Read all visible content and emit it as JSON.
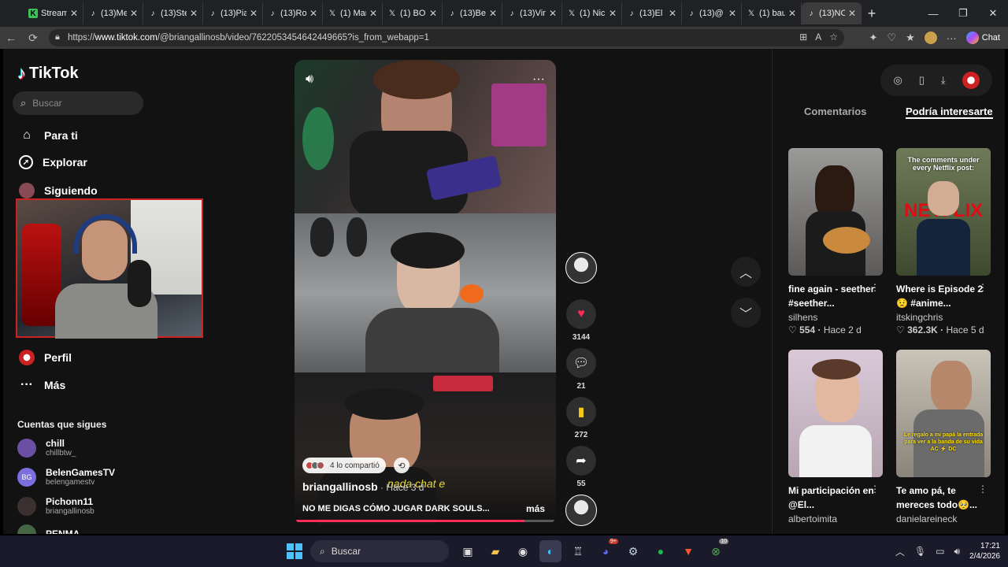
{
  "browser": {
    "tabs": [
      {
        "title": "Stream",
        "icon": "kick-icon"
      },
      {
        "title": "(13)Me",
        "icon": "tiktok-icon"
      },
      {
        "title": "(13)Ste",
        "icon": "tiktok-icon"
      },
      {
        "title": "(13)Pia",
        "icon": "tiktok-icon"
      },
      {
        "title": "(13)Ro",
        "icon": "tiktok-icon"
      },
      {
        "title": "(1) Mar",
        "icon": "x-icon"
      },
      {
        "title": "(1) BO",
        "icon": "x-icon"
      },
      {
        "title": "(13)Be",
        "icon": "tiktok-icon"
      },
      {
        "title": "(13)Vin",
        "icon": "tiktok-icon"
      },
      {
        "title": "(1) Nic",
        "icon": "x-icon"
      },
      {
        "title": "(13)El",
        "icon": "tiktok-icon"
      },
      {
        "title": "(13)@",
        "icon": "tiktok-icon"
      },
      {
        "title": "(1) bau",
        "icon": "x-icon"
      },
      {
        "title": "(13)NO",
        "icon": "tiktok-icon"
      }
    ],
    "url_prefix": "https://",
    "url_host": "www.tiktok.com",
    "url_path": "/@briangallinosb/video/7622053454642449665?is_from_webapp=1",
    "chat_label": "Chat"
  },
  "sidebar": {
    "logo": "TikTok",
    "search_placeholder": "Buscar",
    "items": [
      {
        "label": "Para ti",
        "icon": "home-icon"
      },
      {
        "label": "Explorar",
        "icon": "compass-icon"
      },
      {
        "label": "Siguiendo",
        "icon": "following-icon"
      },
      {
        "label": "Perfil",
        "icon": "profile-icon"
      },
      {
        "label": "Más",
        "icon": "more-icon"
      }
    ],
    "following_header": "Cuentas que sigues",
    "accounts": [
      {
        "name": "chill",
        "handle": "chillbtw_",
        "initials": "",
        "color": "#6a4fa3"
      },
      {
        "name": "BelenGamesTV",
        "handle": "belengamestv",
        "initials": "BG",
        "color": "#7b6fe0"
      },
      {
        "name": "Pichonn11",
        "handle": "briangallinosb",
        "initials": "",
        "color": "#3a3030"
      },
      {
        "name": "PENMA",
        "handle": "",
        "initials": "",
        "color": "#446644"
      }
    ]
  },
  "video": {
    "shared_text": "4 lo compartió",
    "author": "briangallinosb",
    "time_ago": " · Hace 3 d",
    "subtitle": "nada chat e",
    "caption": "NO ME DIGAS CÓMO JUGAR DARK SOULS...",
    "more_label": "más",
    "progress": 0.88
  },
  "actions": {
    "likes": "3144",
    "comments": "21",
    "saves": "272",
    "shares": "55"
  },
  "right_panel": {
    "tab_comments": "Comentarios",
    "tab_suggested": "Podría interesarte",
    "cards": [
      {
        "title": "fine again - seether #seether...",
        "user": "silhens",
        "likes": "554",
        "age": "Hace 2 d",
        "thumb_text": "",
        "thumb_overlay": ""
      },
      {
        "title": "Where is Episode 2😟 #anime...",
        "user": "itskingchris",
        "likes": "362.3K",
        "age": "Hace 5 d",
        "thumb_text": "The comments under every Netflix post:",
        "thumb_overlay": "NETFLIX"
      },
      {
        "title": "Mi participación en @El...",
        "user": "albertoimita",
        "likes": "",
        "age": "",
        "thumb_text": "",
        "thumb_overlay": ""
      },
      {
        "title": "Te amo pá, te mereces todo🥺...",
        "user": "danielareineck",
        "likes": "",
        "age": "",
        "thumb_text": "Le regalo a mi papá la entrada para ver a la banda de su vida AC ⚡ DC",
        "thumb_overlay": ""
      }
    ]
  },
  "taskbar": {
    "search_placeholder": "Buscar",
    "time": "17:21",
    "date": "2/4/2026",
    "badge_discord": "9+",
    "badge_xbox": "10"
  }
}
